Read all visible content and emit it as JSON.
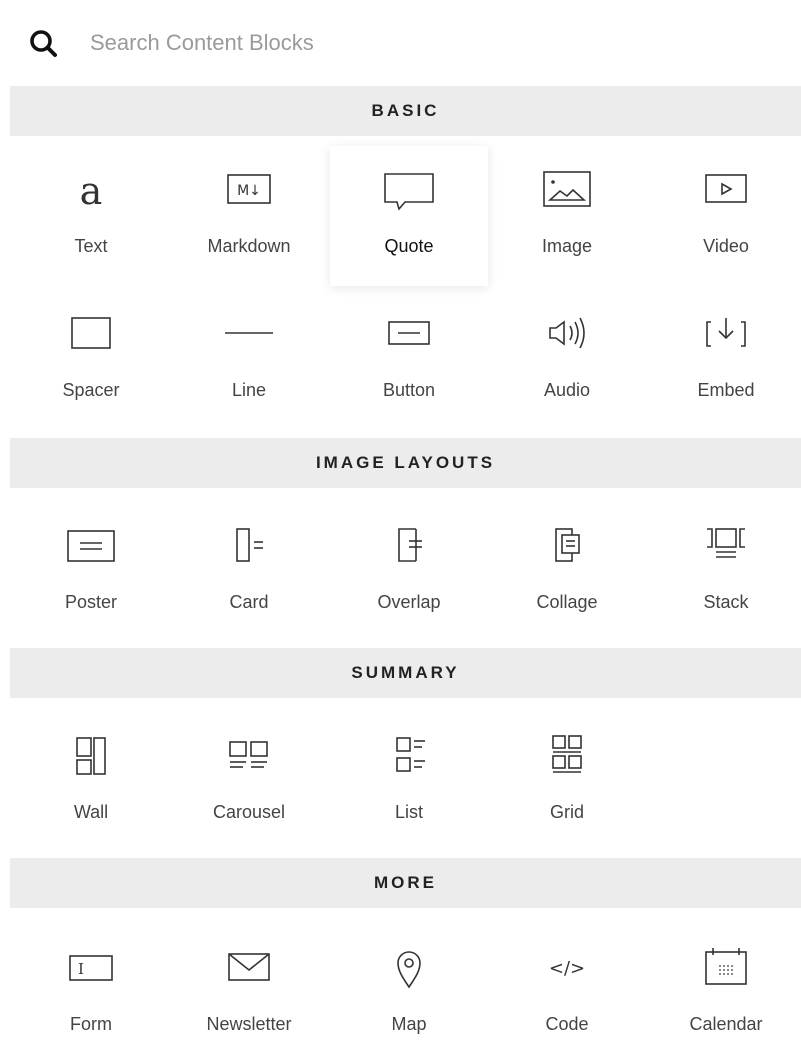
{
  "search": {
    "placeholder": "Search Content Blocks"
  },
  "sections": {
    "basic": {
      "title": "BASIC",
      "blocks": [
        {
          "label": "Text",
          "icon": "text-icon"
        },
        {
          "label": "Markdown",
          "icon": "markdown-icon",
          "icon_text": "M↓"
        },
        {
          "label": "Quote",
          "icon": "quote-icon"
        },
        {
          "label": "Image",
          "icon": "image-icon"
        },
        {
          "label": "Video",
          "icon": "video-icon"
        },
        {
          "label": "Spacer",
          "icon": "spacer-icon"
        },
        {
          "label": "Line",
          "icon": "line-icon"
        },
        {
          "label": "Button",
          "icon": "button-icon"
        },
        {
          "label": "Audio",
          "icon": "audio-icon"
        },
        {
          "label": "Embed",
          "icon": "embed-icon"
        }
      ]
    },
    "image_layouts": {
      "title": "IMAGE LAYOUTS",
      "blocks": [
        {
          "label": "Poster",
          "icon": "poster-icon"
        },
        {
          "label": "Card",
          "icon": "card-icon"
        },
        {
          "label": "Overlap",
          "icon": "overlap-icon"
        },
        {
          "label": "Collage",
          "icon": "collage-icon"
        },
        {
          "label": "Stack",
          "icon": "stack-icon"
        }
      ]
    },
    "summary": {
      "title": "SUMMARY",
      "blocks": [
        {
          "label": "Wall",
          "icon": "wall-icon"
        },
        {
          "label": "Carousel",
          "icon": "carousel-icon"
        },
        {
          "label": "List",
          "icon": "list-icon"
        },
        {
          "label": "Grid",
          "icon": "grid-icon"
        }
      ]
    },
    "more": {
      "title": "MORE",
      "blocks": [
        {
          "label": "Form",
          "icon": "form-icon",
          "icon_text": "I"
        },
        {
          "label": "Newsletter",
          "icon": "newsletter-icon"
        },
        {
          "label": "Map",
          "icon": "map-pin-icon"
        },
        {
          "label": "Code",
          "icon": "code-icon",
          "icon_text": "</>"
        },
        {
          "label": "Calendar",
          "icon": "calendar-icon"
        }
      ]
    }
  }
}
